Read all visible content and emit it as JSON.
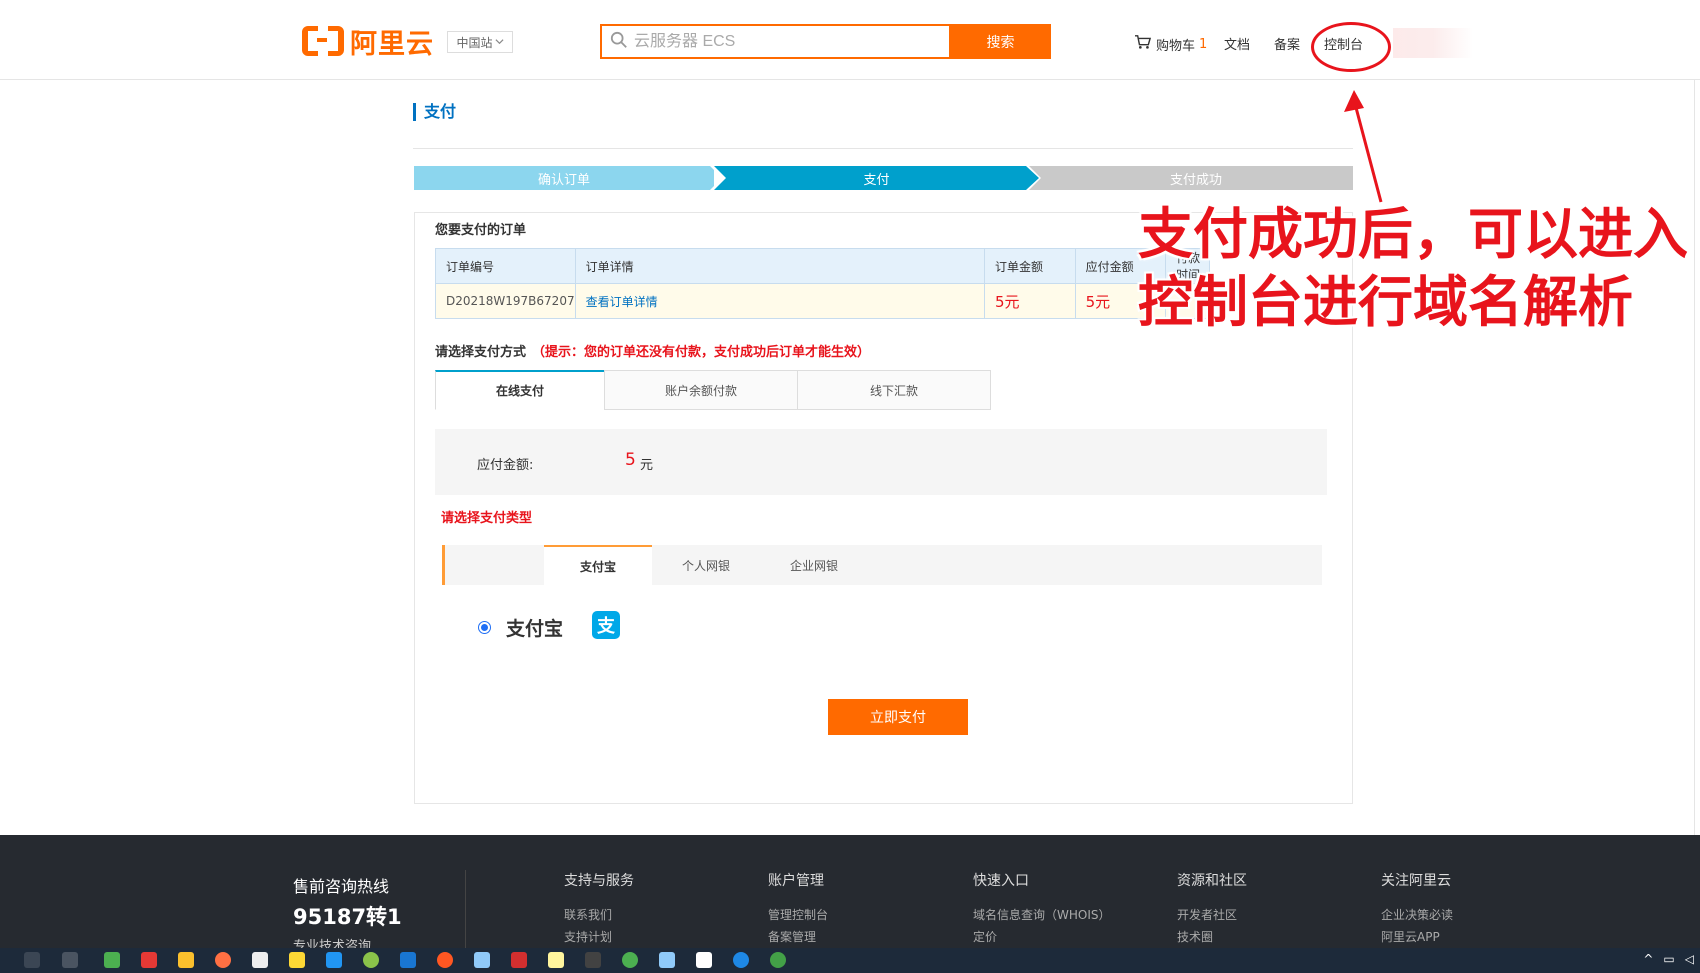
{
  "header": {
    "logo_text": "阿里云",
    "region": "中国站",
    "search_placeholder": "云服务器 ECS",
    "search_button": "搜索",
    "nav": {
      "cart_label": "购物车",
      "cart_count": "1",
      "docs": "文档",
      "filing": "备案",
      "console": "控制台"
    }
  },
  "page": {
    "title": "支付",
    "steps": [
      "确认订单",
      "支付",
      "支付成功"
    ],
    "active_step": 1
  },
  "order": {
    "heading": "您要支付的订单",
    "columns": [
      "订单编号",
      "订单详情",
      "订单金额",
      "应付金额",
      "付款时间"
    ],
    "row": {
      "id": "D20218W197B67207",
      "detail_link": "查看订单详情",
      "amount": "5元",
      "payable": "5元"
    }
  },
  "payment_method": {
    "heading": "请选择支付方式",
    "hint": "（提示：您的订单还没有付款，支付成功后订单才能生效）",
    "tabs": [
      "在线支付",
      "账户余额付款",
      "线下汇款"
    ],
    "active_tab": 0
  },
  "amount": {
    "label": "应付金额:",
    "value": "5",
    "unit": "元"
  },
  "payment_type": {
    "heading": "请选择支付类型",
    "tabs": [
      "支付宝",
      "个人网银",
      "企业网银"
    ],
    "active_tab": 0,
    "selected_label": "支付宝",
    "icon_glyph": "支"
  },
  "pay_button": "立即支付",
  "annotation": {
    "line1": "支付成功后，可以进入",
    "line2": "控制台进行域名解析",
    "color": "#e8141c"
  },
  "footer": {
    "hotline_title": "售前咨询热线",
    "hotline_number": "95187转1",
    "hotline_sub": "专业技术咨询",
    "columns": [
      {
        "title": "支持与服务",
        "links": [
          "联系我们",
          "支持计划"
        ]
      },
      {
        "title": "账户管理",
        "links": [
          "管理控制台",
          "备案管理"
        ]
      },
      {
        "title": "快速入口",
        "links": [
          "域名信息查询（WHOIS）",
          "定价"
        ]
      },
      {
        "title": "资源和社区",
        "links": [
          "开发者社区",
          "技术圈"
        ]
      },
      {
        "title": "关注阿里云",
        "links": [
          "企业决策必读",
          "阿里云APP"
        ]
      }
    ]
  },
  "colors": {
    "brand_orange": "#ff6a00",
    "link_blue": "#0071c1",
    "step_active": "#00a0cc",
    "alert_red": "#e8141c"
  }
}
